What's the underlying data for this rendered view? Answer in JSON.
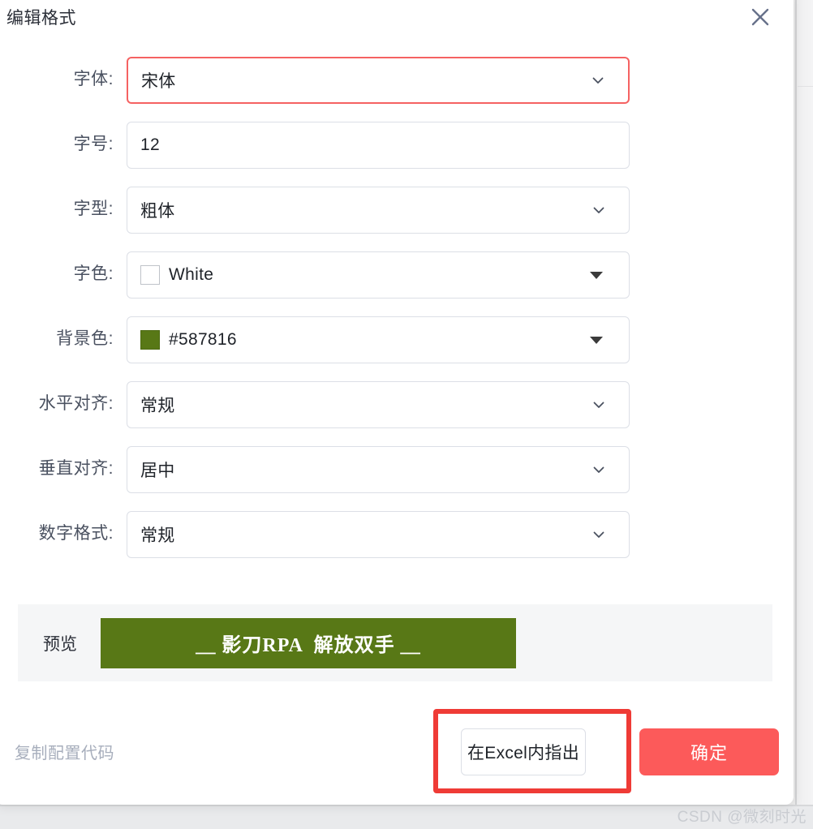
{
  "dialog": {
    "title": "编辑格式",
    "close_icon": "close-x-icon"
  },
  "form": {
    "fields": [
      {
        "label": "字体:",
        "value": "宋体",
        "control": "select",
        "highlighted": true
      },
      {
        "label": "字号:",
        "value": "12",
        "control": "input",
        "highlighted": false
      },
      {
        "label": "字型:",
        "value": "粗体",
        "control": "select",
        "highlighted": false
      },
      {
        "label": "字色:",
        "value": "White",
        "control": "color-select",
        "highlighted": false,
        "swatch": "#FFFFFF"
      },
      {
        "label": "背景色:",
        "value": "#587816",
        "control": "color-select",
        "highlighted": false,
        "swatch": "#587816"
      },
      {
        "label": "水平对齐:",
        "value": "常规",
        "control": "select",
        "highlighted": false
      },
      {
        "label": "垂直对齐:",
        "value": "居中",
        "control": "select",
        "highlighted": false
      },
      {
        "label": "数字格式:",
        "value": "常规",
        "control": "select",
        "highlighted": false
      }
    ]
  },
  "preview": {
    "label": "预览",
    "text": "＿ 影刀RPA  解放双手 ＿",
    "background_color": "#587816",
    "text_color": "#FFFFFF"
  },
  "footer": {
    "copy_config_label": "复制配置代码",
    "excel_button_label": "在Excel内指出",
    "confirm_button_label": "确定",
    "confirm_button_color": "#FC5A5A",
    "annotation_color": "#EF3B36"
  },
  "watermark": {
    "text": "CSDN @微刻时光"
  }
}
